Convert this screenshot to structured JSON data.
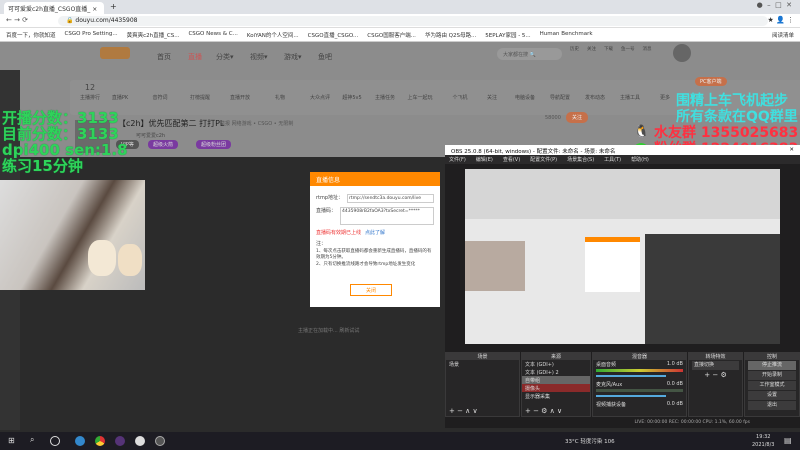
{
  "browser": {
    "tab_title": "可可爱爱c2h直播_CSGO直播_",
    "new_tab": "+",
    "url": "douyu.com/4435908",
    "bookmarks": [
      "百度一下，你就知道",
      "CSGO Pro Setting...",
      "黄爽爽c2h直播_CS...",
      "CSGO News & C...",
      "KoiYAN的个人空间...",
      "CSGO直播_CSGO...",
      "CSGO国服客户端...",
      "华为路由 Q2S母路...",
      "5EPLAY家园 - 5...",
      "Human Benchmark"
    ],
    "reading_list": "阅读清单"
  },
  "douyu": {
    "nav": [
      "首页",
      "直播",
      "分类▾",
      "视频▾",
      "游戏▾",
      "鱼吧"
    ],
    "search_placeholder": "大家都在搜",
    "user_icons": [
      "历史",
      "关注",
      "下载",
      "鱼一号",
      "消息"
    ],
    "toolbar_count": "12",
    "toolbar": [
      "主播排行",
      "直播PK",
      "音符词",
      "打榜提醒",
      "直播开放",
      "礼物",
      "大众点评",
      "超神5v5",
      "主播任务",
      "上车一起玩",
      "个飞机",
      "关注",
      "电脑设备",
      "导航配置",
      "发布动态",
      "主播工具",
      "更多"
    ],
    "pc_client": "PC客户端",
    "stream_title": "【c2h】优先匹配第二 打打PL",
    "stream_meta": "举报  网络游戏 • CSGO • 无限制",
    "streamer": "可可爱爱c2h",
    "followers": "58000",
    "follow": "关注",
    "tag1": "VIP等",
    "tag2": "超级火箭",
    "tag3": "超级粉丝团",
    "loading": "主播正在加载中...  刷新试试"
  },
  "overlay": {
    "left": [
      "开播分数：3133",
      "目前分数：3133",
      "dpi400 sen:1.8",
      "练习15分钟"
    ],
    "right": [
      "围精上车飞机起步",
      "所有条款在QQ群里",
      "水友群 1355025683",
      "粉丝群 1224016383"
    ]
  },
  "dialog": {
    "title": "直播信息",
    "rtmp_label": "rtmp地址：",
    "rtmp_value": "rtmp://sendtc3a.douyu.com/live",
    "code_label": "直播码：",
    "code_value": "4435908rB2faOA3?txSecret=*****",
    "warning": "直播码有效期已上线",
    "link": "点此了解",
    "note_title": "注：",
    "note1": "1、每次点击获取直播码都会重新生成直播码，直播码的有效期为5分钟。",
    "note2": "2、只有切换推流线路才会导致rtmp地址发生变化",
    "close": "关闭"
  },
  "obs": {
    "title": "OBS 25.0.8 (64-bit, windows) - 配置文件: 未命名 - 场景: 未命名",
    "menu": [
      "文件(F)",
      "编辑(E)",
      "查看(V)",
      "配置文件(P)",
      "场景集合(S)",
      "工具(T)",
      "帮助(H)"
    ],
    "docks": {
      "scenes": "场景",
      "sources": "来源",
      "mixer": "混音器",
      "transitions": "转场特效",
      "controls": "控制"
    },
    "scene_items": [
      "场景"
    ],
    "sources": [
      "文本 (GDI+)",
      "文本 (GDI+) 2",
      "自带组",
      "摄像头",
      "显示器采集"
    ],
    "mixer": [
      {
        "name": "桌面音频",
        "db": "1.0 dB"
      },
      {
        "name": "麦克风/Aux",
        "db": "0.0 dB"
      },
      {
        "name": "视频捕获设备",
        "db": "0.0 dB"
      }
    ],
    "transition": "直接切换",
    "controls": [
      "停止推流",
      "开始录制",
      "工作室模式",
      "设置",
      "退出"
    ],
    "status": "LIVE: 00:00:00   REC: 00:00:00   CPU: 1.1%, 60.00 fps"
  },
  "taskbar": {
    "weather": "33°C 轻度污染 106",
    "time": "19:32",
    "date": "2021/8/3"
  }
}
